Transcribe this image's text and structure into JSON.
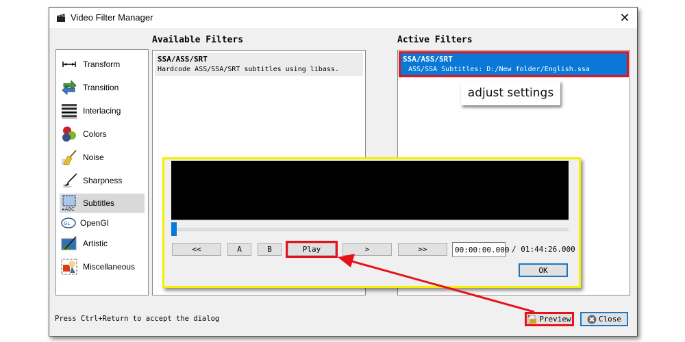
{
  "window": {
    "title": "Video Filter Manager",
    "close_glyph": "✕"
  },
  "categories": {
    "items": [
      {
        "label": "Transform",
        "icon": "transform-icon"
      },
      {
        "label": "Transition",
        "icon": "transition-icon"
      },
      {
        "label": "Interlacing",
        "icon": "interlacing-icon"
      },
      {
        "label": "Colors",
        "icon": "colors-icon"
      },
      {
        "label": "Noise",
        "icon": "noise-icon"
      },
      {
        "label": "Sharpness",
        "icon": "sharpness-icon"
      },
      {
        "label": "Subtitles",
        "icon": "subtitles-icon",
        "selected": true
      },
      {
        "label": "OpenGl",
        "icon": "opengl-icon"
      },
      {
        "label": "Artistic",
        "icon": "artistic-icon"
      },
      {
        "label": "Miscellaneous",
        "icon": "miscellaneous-icon"
      }
    ]
  },
  "available": {
    "title": "Available Filters",
    "filters": [
      {
        "name": "SSA/ASS/SRT",
        "description": "Hardcode ASS/SSA/SRT subtitles using libass."
      }
    ]
  },
  "active": {
    "title": "Active Filters",
    "filters": [
      {
        "name": "SSA/ASS/SRT",
        "description": "ASS/SSA Subtitles: D:/New folder/English.ssa"
      }
    ]
  },
  "annotation": {
    "callout": "adjust settings",
    "highlight_color": "#e8111a",
    "panel_border_color": "#f5f000"
  },
  "preview": {
    "buttons": {
      "rewind": "<<",
      "mark_a": "A",
      "mark_b": "B",
      "play": "Play",
      "next_frame": ">",
      "forward": ">>"
    },
    "current_time": "00:00:00.000",
    "total_time": "/ 01:44:26.000",
    "position_fraction": 0,
    "ok_label": "OK"
  },
  "footer": {
    "status": "Press Ctrl+Return to accept the dialog",
    "preview_label": "Preview",
    "close_label": "Close"
  },
  "colors": {
    "selection_blue": "#0a78d7",
    "focus_blue": "#1a77c4"
  }
}
